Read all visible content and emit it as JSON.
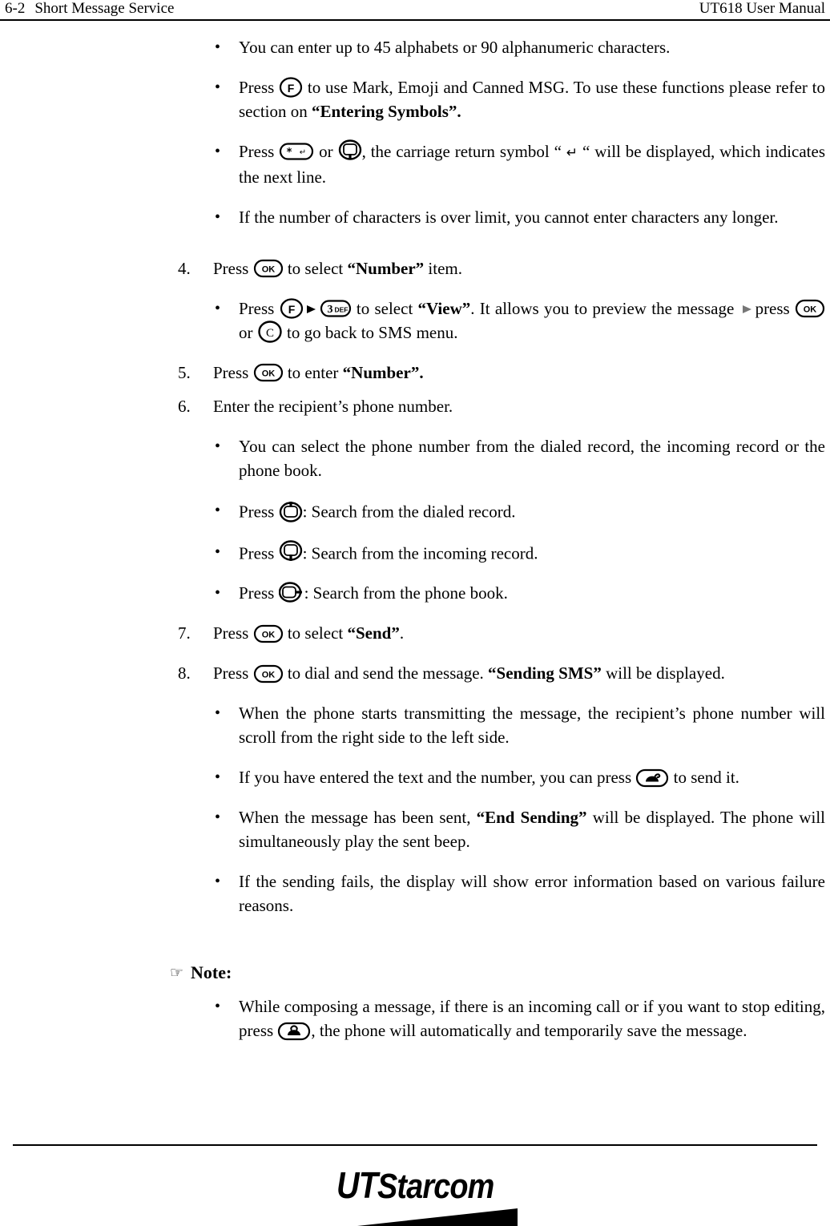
{
  "header": {
    "page_number": "6-2",
    "section_title": "Short Message Service",
    "manual_title": "UT618 User Manual"
  },
  "icons": {
    "f_key": "f-key-icon",
    "ok_key": "ok-key-icon",
    "c_key": "c-key-icon",
    "star_key": "star-key-icon",
    "three_def_key": "three-def-key-icon",
    "nav_up_key": "nav-up-key-icon",
    "nav_down_key": "nav-down-key-icon",
    "nav_left_key": "nav-left-key-icon",
    "send_key": "send-call-key-icon",
    "end_key": "end-call-key-icon",
    "right_arrow": "right-arrow-icon",
    "hand_pointer": "pointing-hand-icon"
  },
  "content": {
    "b1": {
      "text": "You can enter up to 45 alphabets or 90 alphanumeric characters."
    },
    "b2": {
      "pre": "Press ",
      "mid": " to use Mark, Emoji and Canned MSG. To use these functions please refer to section on  ",
      "bold": "“Entering Symbols”."
    },
    "b3": {
      "pre": "Press ",
      "mid1": " or ",
      "mid2": ", the carriage return symbol “ ",
      "cr": "↵",
      "mid3": " “ will be displayed, which indicates the next line."
    },
    "b4": {
      "text": "If the number of characters is over limit, you cannot enter characters any longer."
    },
    "s4": {
      "num": "4.",
      "pre": "Press ",
      "mid": " to select ",
      "bold": "“Number”",
      "post": " item."
    },
    "s4b1": {
      "pre": "Press ",
      "mid1": " to select ",
      "bold1": "“View”",
      "mid2": ". It allows you to preview the message ",
      "mid3": "press ",
      "mid4": " or ",
      "post": " to go back to SMS menu."
    },
    "s5": {
      "num": "5.",
      "pre": "Press ",
      "mid": " to enter ",
      "bold": "“Number”."
    },
    "s6": {
      "num": "6.",
      "text": "Enter the recipient’s phone number."
    },
    "s6b1": {
      "text": "You can select the phone number from the dialed record, the incoming record or the phone book."
    },
    "s6b2": {
      "pre": "Press ",
      "post": ": Search from the dialed record."
    },
    "s6b3": {
      "pre": "Press ",
      "post": ": Search from the incoming record."
    },
    "s6b4": {
      "pre": "Press ",
      "post": ": Search from the phone book."
    },
    "s7": {
      "num": "7.",
      "pre": "Press ",
      "mid": " to select ",
      "bold": "“Send”",
      "post": "."
    },
    "s8": {
      "num": "8.",
      "pre": "Press ",
      "mid": " to dial and send the message. ",
      "bold": "“Sending SMS”",
      "post": " will be displayed."
    },
    "s8b1": {
      "text": "When the phone starts transmitting the message, the recipient’s phone number will scroll from the right side to the left side."
    },
    "s8b2": {
      "pre": "If you have entered the text and the number, you can press ",
      "post": " to send it."
    },
    "s8b3": {
      "pre": "When the message has been sent, ",
      "bold": "“End Sending”",
      "post": " will be displayed. The phone will simultaneously play the sent beep."
    },
    "s8b4": {
      "text": "If the sending fails, the display will show error information based on various failure reasons."
    },
    "note": {
      "hand": "☞",
      "title": "Note:",
      "b1_pre": "While composing a message, if there is an incoming call or if you want to stop editing, press ",
      "b1_post": ", the phone will automatically and temporarily save the message."
    }
  },
  "footer": {
    "logo_ut": "UT",
    "logo_starcom": "Starcom"
  }
}
